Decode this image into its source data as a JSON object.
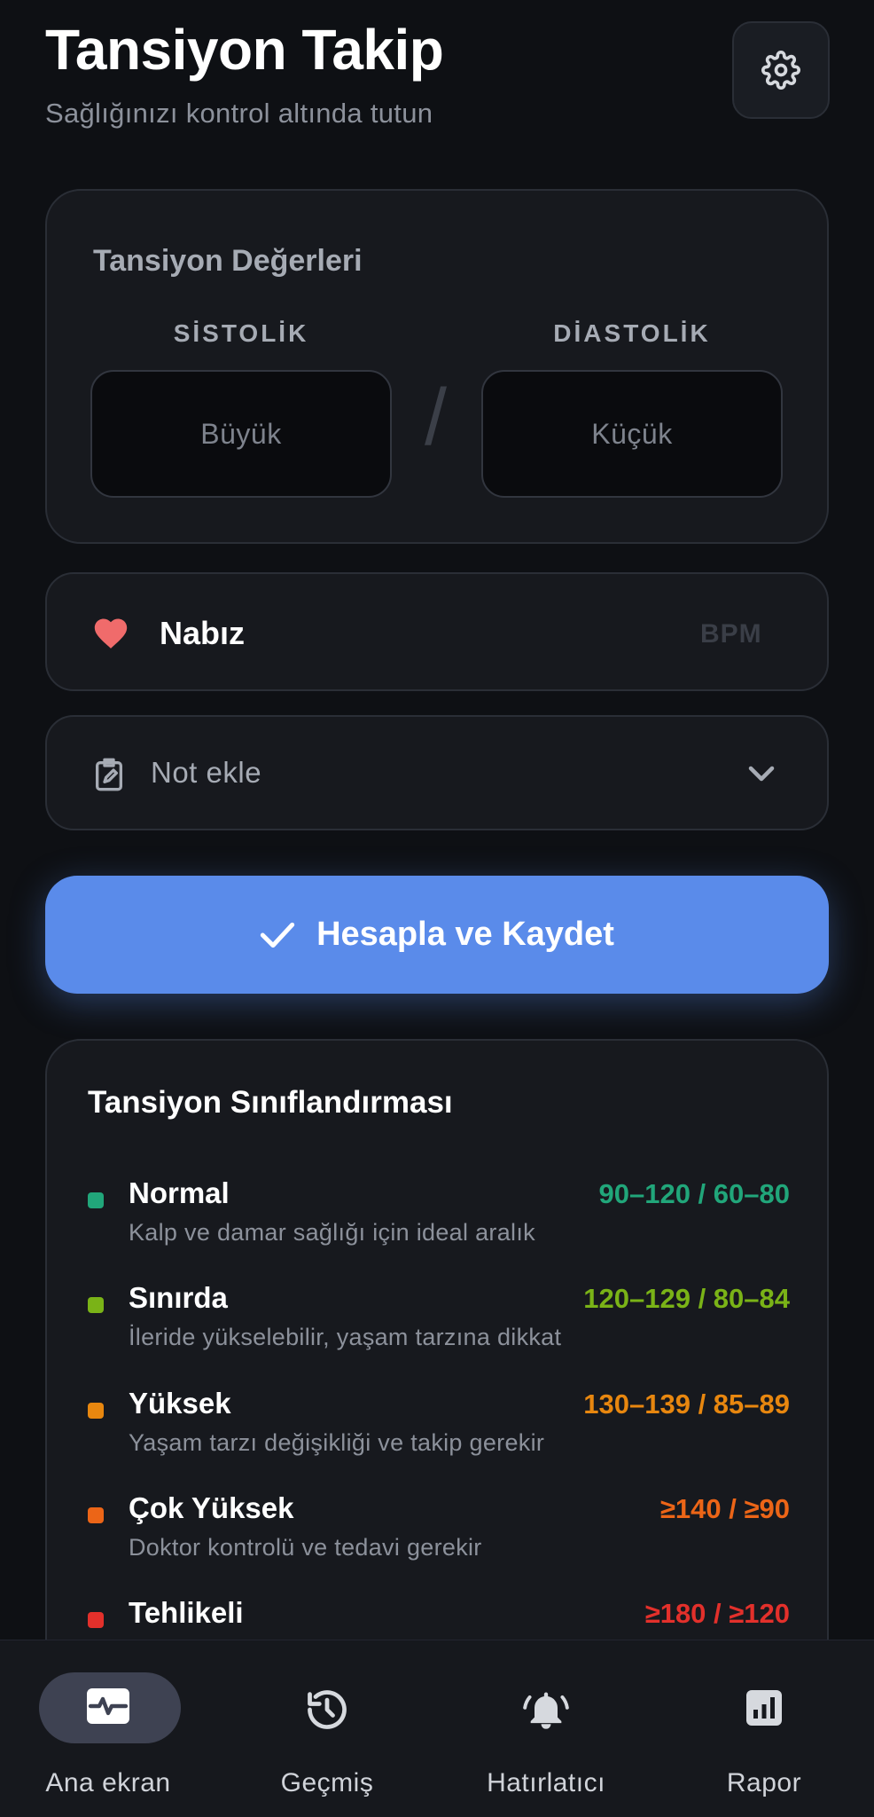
{
  "header": {
    "title": "Tansiyon Takip",
    "subtitle": "Sağlığınızı kontrol altında tutun"
  },
  "bp_card": {
    "title": "Tansiyon Değerleri",
    "systolic_label": "SİSTOLİK",
    "diastolic_label": "DİASTOLİK",
    "systolic_placeholder": "Büyük",
    "diastolic_placeholder": "Küçük",
    "separator": "/"
  },
  "pulse": {
    "label": "Nabız",
    "unit": "BPM",
    "icon": "heart-icon"
  },
  "note": {
    "label": "Not ekle",
    "icon": "clipboard-edit-icon"
  },
  "submit": {
    "label": "Hesapla ve Kaydet",
    "icon": "check-icon"
  },
  "classification": {
    "title": "Tansiyon Sınıflandırması",
    "rows": [
      {
        "name": "Normal",
        "range": "90–120 / 60–80",
        "desc": "Kalp ve damar sağlığı için ideal aralık",
        "color": "#21a67a"
      },
      {
        "name": "Sınırda",
        "range": "120–129 / 80–84",
        "desc": "İleride yükselebilir, yaşam tarzına dikkat",
        "color": "#7ab317"
      },
      {
        "name": "Yüksek",
        "range": "130–139 / 85–89",
        "desc": "Yaşam tarzı değişikliği ve takip gerekir",
        "color": "#e8870f"
      },
      {
        "name": "Çok Yüksek",
        "range": "≥140 / ≥90",
        "desc": "Doktor kontrolü ve tedavi gerekir",
        "color": "#ec6517"
      },
      {
        "name": "Tehlikeli",
        "range": "≥180 / ≥120",
        "desc": "",
        "color": "#e3302b"
      }
    ]
  },
  "nav": {
    "items": [
      {
        "label": "Ana ekran",
        "icon": "activity-icon",
        "active": true
      },
      {
        "label": "Geçmiş",
        "icon": "history-icon",
        "active": false
      },
      {
        "label": "Hatırlatıcı",
        "icon": "bell-icon",
        "active": false
      },
      {
        "label": "Rapor",
        "icon": "chart-icon",
        "active": false
      }
    ]
  },
  "colors": {
    "accent": "#5a8bea",
    "background": "#0e1014",
    "card": "#17191e",
    "heart": "#f06b6b"
  }
}
